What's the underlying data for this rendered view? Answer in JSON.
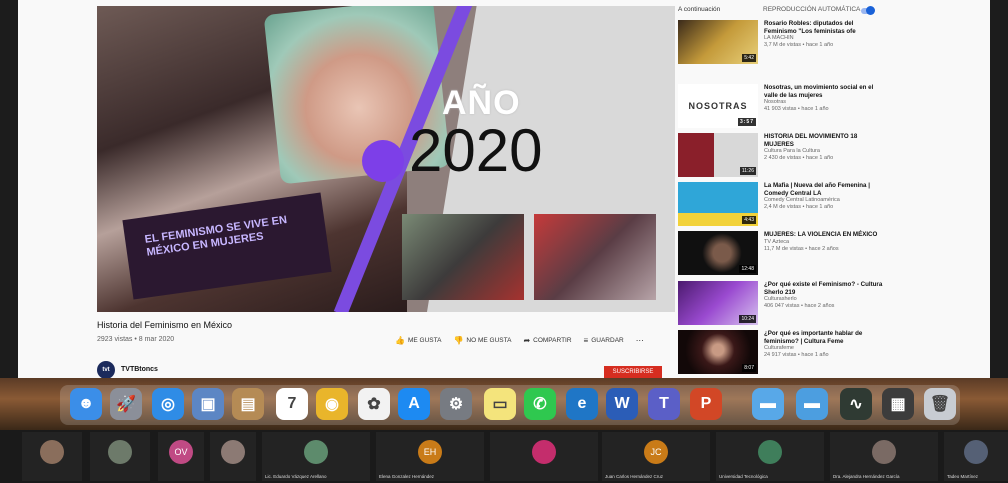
{
  "video": {
    "overlay_word": "AÑO",
    "overlay_year": "2020",
    "banner_text": "EL FEMINISMO SE VIVE EN MÉXICO EN MUJERES",
    "title": "Historia del Feminismo en México",
    "meta": "2923 vistas • 8 mar 2020",
    "actions": {
      "like": "ME GUSTA",
      "dislike": "NO ME GUSTA",
      "share": "COMPARTIR",
      "save": "GUARDAR"
    },
    "channel_name": "TVTBtoncs",
    "channel_avatar": "tvt",
    "subscribe": "SUSCRIBIRSE"
  },
  "sidebar": {
    "up_next": "A continuación",
    "autoplay": "REPRODUCCIÓN AUTOMÁTICA",
    "items": [
      {
        "title": "Rosario Robles: diputados del Feminismo \"Los feministas ofe",
        "channel": "LA MACHIN",
        "views": "3,7 M de vistas • hace 1 año",
        "duration": "5:42"
      },
      {
        "title": "Nosotras, un movimiento social en el valle de las mujeres",
        "channel": "Nosotras",
        "views": "41 903 vistas • hace 1 año",
        "duration": "3:57"
      },
      {
        "title": "HISTORIA DEL MOVIMIENTO 18 MUJERES",
        "channel": "Cultura Para la Cultura",
        "views": "2 430 de vistas • hace 1 año",
        "duration": "11:26"
      },
      {
        "title": "La Mafia | Nueva del año Femenina | Comedy Central LA",
        "channel": "Comedy Central Latinoamérica",
        "views": "2,4 M de vistas • hace 1 año",
        "duration": "4:43"
      },
      {
        "title": "MUJERES: LA VIOLENCIA EN MÉXICO",
        "channel": "TV Azteca",
        "views": "11,7 M de vistas • hace 2 años",
        "duration": "12:48"
      },
      {
        "title": "¿Por qué existe el Feminismo? - Cultura Sherlo 219",
        "channel": "Culturasherlo",
        "views": "406 047 vistas • hace 2 años",
        "duration": "10:24"
      },
      {
        "title": "¿Por qué es importante hablar de feminismo? | Cultura Feme",
        "channel": "Culturafeme",
        "views": "24 917 vistas • hace 1 año",
        "duration": "8:07"
      }
    ],
    "nosotras_label": "NOSOTRAS"
  },
  "dock": {
    "icons": [
      {
        "name": "finder-icon",
        "color": "#3b8ee8",
        "glyph": "☻"
      },
      {
        "name": "launchpad-icon",
        "color": "#8b8f99",
        "glyph": "🚀"
      },
      {
        "name": "safari-icon",
        "color": "#2f8ce6",
        "glyph": "◎"
      },
      {
        "name": "preview-icon",
        "color": "#5c86c4",
        "glyph": "▣"
      },
      {
        "name": "notes-app-icon",
        "color": "#b58b55",
        "glyph": "▤"
      },
      {
        "name": "calendar-icon",
        "color": "#ffffff",
        "glyph": "7"
      },
      {
        "name": "chrome-icon",
        "color": "#e9b52b",
        "glyph": "◉"
      },
      {
        "name": "photos-icon",
        "color": "#f2f2f2",
        "glyph": "✿"
      },
      {
        "name": "app-store-icon",
        "color": "#1d8af2",
        "glyph": "A"
      },
      {
        "name": "system-preferences-icon",
        "color": "#777b82",
        "glyph": "⚙"
      },
      {
        "name": "stickies-icon",
        "color": "#f4e47c",
        "glyph": "▭"
      },
      {
        "name": "whatsapp-icon",
        "color": "#2fc84f",
        "glyph": "✆"
      },
      {
        "name": "edge-icon",
        "color": "#1f76c6",
        "glyph": "e"
      },
      {
        "name": "word-icon",
        "color": "#2b5db7",
        "glyph": "W"
      },
      {
        "name": "teams-icon",
        "color": "#5b5fc7",
        "glyph": "T"
      },
      {
        "name": "powerpoint-icon",
        "color": "#d24726",
        "glyph": "P"
      },
      {
        "name": "folder-icon",
        "color": "#58a8e8",
        "glyph": "▬"
      },
      {
        "name": "downloads-folder-icon",
        "color": "#4c9ee0",
        "glyph": "▬"
      },
      {
        "name": "activity-monitor-icon",
        "color": "#2f3a33",
        "glyph": "∿"
      },
      {
        "name": "screen-recorder-icon",
        "color": "#3c3c3c",
        "glyph": "▦"
      },
      {
        "name": "trash-icon",
        "color": "#c8ccd2",
        "glyph": "🗑"
      }
    ]
  },
  "zoom": {
    "participants": [
      {
        "initials": "",
        "name": "",
        "avatar_color": "#8a6e5c"
      },
      {
        "initials": "",
        "name": "",
        "avatar_color": "#6d7a6a"
      },
      {
        "initials": "OV",
        "name": "",
        "avatar_color": "#c04a84"
      },
      {
        "initials": "",
        "name": "",
        "avatar_color": "#8c7a74"
      },
      {
        "initials": "",
        "name": "Lic. Eduardo Vázquez Arellano",
        "avatar_color": "#5d8b6c"
      },
      {
        "initials": "EH",
        "name": "Elena Gonzalez Hernández",
        "avatar_color": "#c97b18"
      },
      {
        "initials": "",
        "name": "",
        "avatar_color": "#c42d6c"
      },
      {
        "initials": "JC",
        "name": "Juan Carlos Hernández Cruz",
        "avatar_color": "#c97b18"
      },
      {
        "initials": "",
        "name": "Universidad Tecnológica",
        "avatar_color": "#3f7e5b"
      },
      {
        "initials": "",
        "name": "Dra. Alejandra Hernández García",
        "avatar_color": "#7a6a64"
      },
      {
        "initials": "",
        "name": "Tadeo Martínez",
        "avatar_color": "#556075"
      }
    ]
  }
}
